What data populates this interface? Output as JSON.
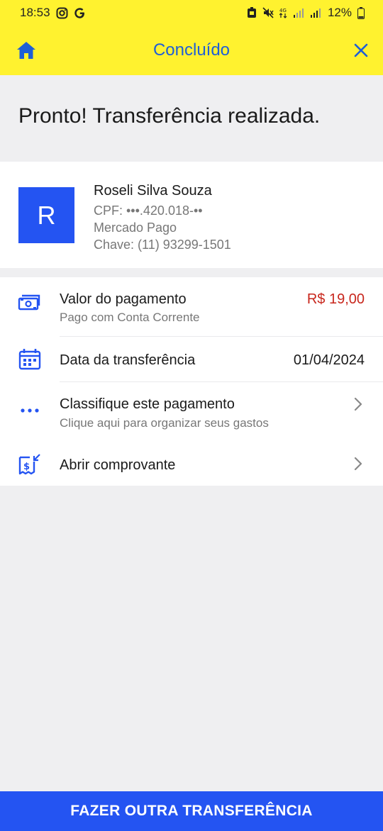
{
  "status_bar": {
    "time": "18:53",
    "battery": "12%",
    "icons": [
      "instagram-icon",
      "google-icon",
      "battery-saver-icon",
      "mute-icon",
      "4g-icon",
      "signal-icon",
      "signal-icon",
      "battery-icon"
    ]
  },
  "app_bar": {
    "title": "Concluído",
    "home_icon": "home-icon",
    "close_icon": "close-icon"
  },
  "headline": "Pronto! Transferência realizada.",
  "recipient": {
    "initial": "R",
    "name": "Roseli Silva Souza",
    "cpf": "CPF: •••.420.018-••",
    "bank": "Mercado Pago",
    "key": "Chave: (11) 93299-1501"
  },
  "details": {
    "payment": {
      "title": "Valor do pagamento",
      "subtitle": "Pago com Conta Corrente",
      "value": "R$ 19,00",
      "value_color": "#c8271d"
    },
    "date": {
      "title": "Data da transferência",
      "value": "01/04/2024"
    },
    "classify": {
      "title": "Classifique este pagamento",
      "subtitle": "Clique aqui para organizar seus gastos"
    },
    "receipt": {
      "title": "Abrir comprovante"
    }
  },
  "footer_button": "FAZER OUTRA TRANSFERÊNCIA",
  "colors": {
    "yellow": "#fff22f",
    "brand_blue": "#2454f2",
    "title_blue": "#1f5fd6"
  }
}
